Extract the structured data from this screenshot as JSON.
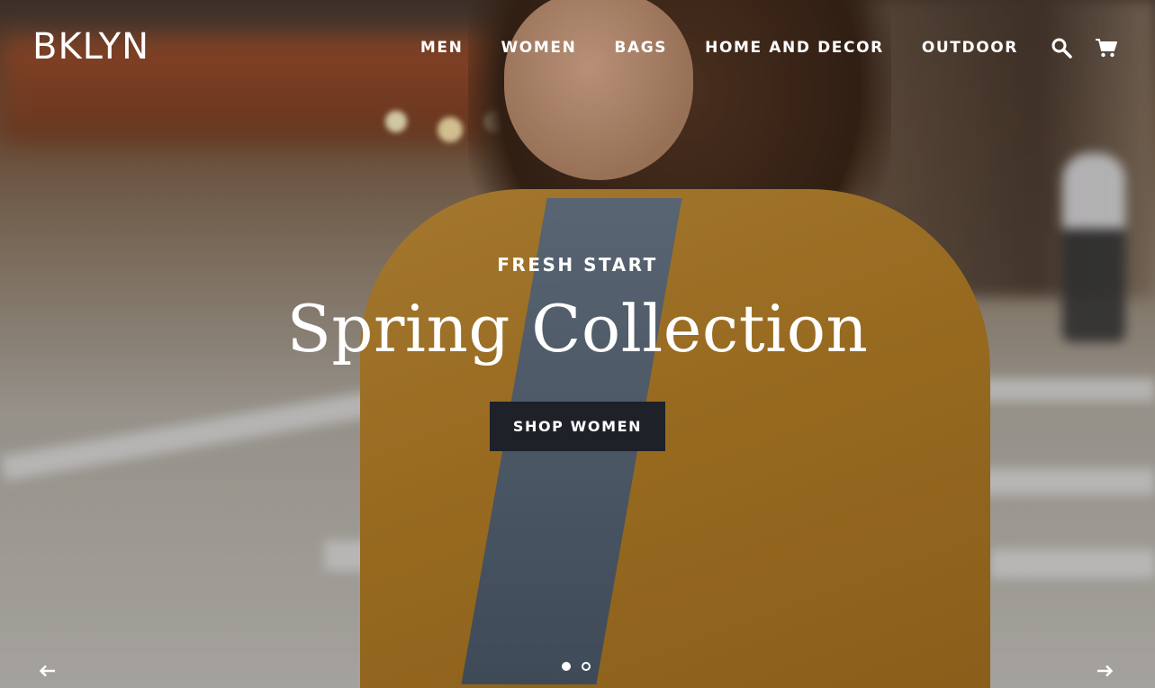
{
  "header": {
    "logo": "BKLYN",
    "nav": [
      {
        "label": "MEN"
      },
      {
        "label": "WOMEN"
      },
      {
        "label": "BAGS"
      },
      {
        "label": "HOME AND DECOR"
      },
      {
        "label": "OUTDOOR"
      }
    ],
    "icons": [
      "search-icon",
      "cart-icon"
    ]
  },
  "hero": {
    "eyebrow": "FRESH START",
    "headline": "Spring Collection",
    "cta_label": "SHOP WOMEN"
  },
  "slider": {
    "slides": 2,
    "active_slide": 1,
    "prev_icon": "arrow-left-icon",
    "next_icon": "arrow-right-icon"
  },
  "colors": {
    "text": "#ffffff",
    "cta_bg": "#1e2128"
  }
}
